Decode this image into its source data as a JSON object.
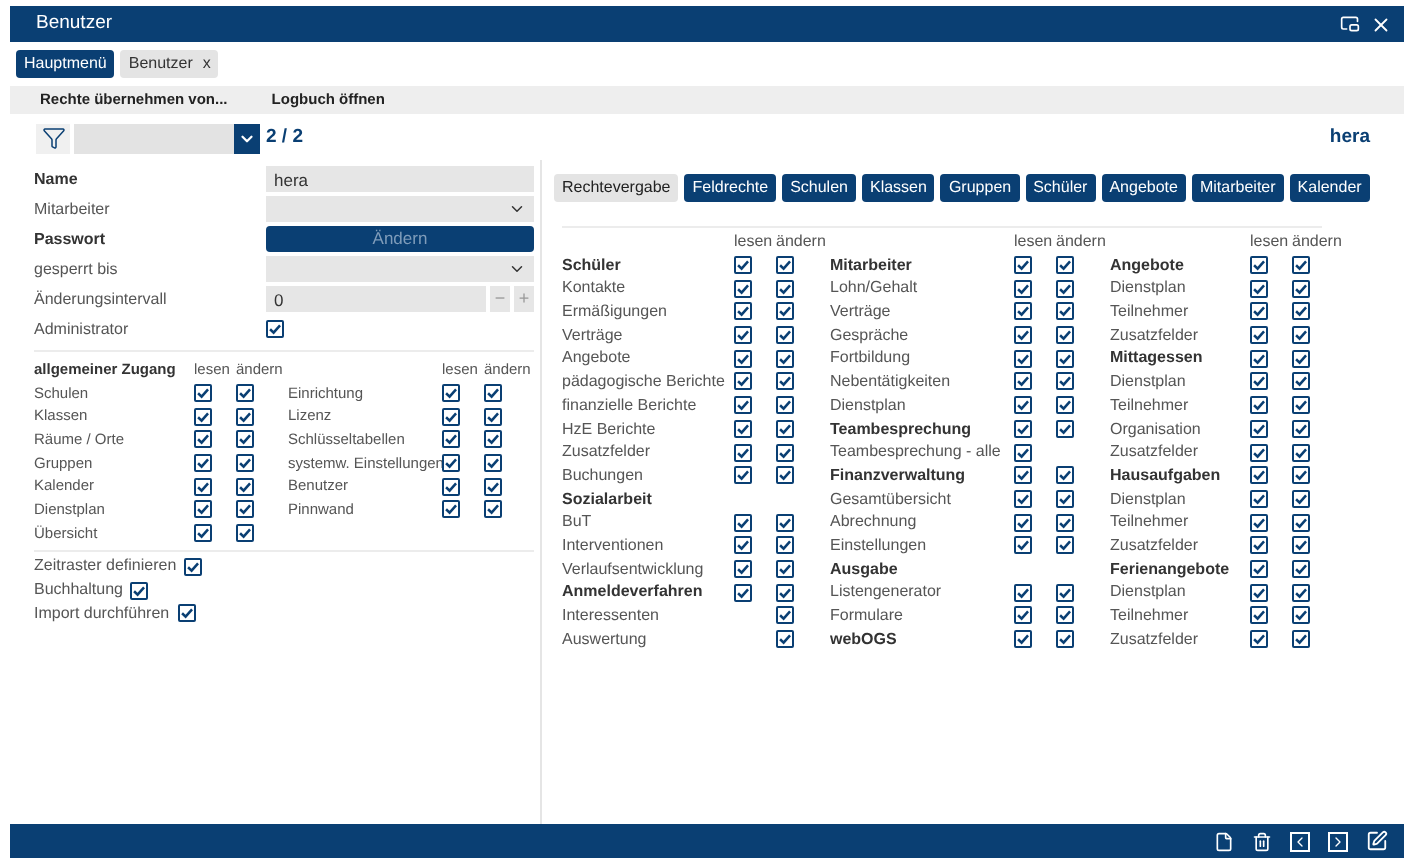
{
  "window": {
    "title": "Benutzer"
  },
  "tabs": [
    {
      "label": "Hauptmenü",
      "selected": true
    },
    {
      "label": "Benutzer",
      "selected": false,
      "close": "x"
    }
  ],
  "toolbar": [
    "Rechte übernehmen von...",
    "Logbuch öffnen"
  ],
  "navigator": {
    "counter": "2 / 2",
    "user": "hera"
  },
  "form": [
    {
      "kind": "text",
      "label": "Name",
      "required": true,
      "value": "hera"
    },
    {
      "kind": "select",
      "label": "Mitarbeiter",
      "required": false
    },
    {
      "kind": "button",
      "label": "Passwort",
      "required": true,
      "button": "Ändern",
      "disabled": true
    },
    {
      "kind": "select",
      "label": "gesperrt bis",
      "required": false
    },
    {
      "kind": "stepper",
      "label": "Änderungsintervall",
      "required": false,
      "value": "0",
      "minus": "−",
      "plus": "+"
    },
    {
      "kind": "checkbox",
      "label": "Administrator",
      "required": false,
      "checked": true
    }
  ],
  "general_access": {
    "title": "allgemeiner Zugang",
    "headers": [
      "lesen",
      "ändern"
    ],
    "left": [
      {
        "label": "Schulen",
        "read": true,
        "write": true
      },
      {
        "label": "Klassen",
        "read": true,
        "write": true
      },
      {
        "label": "Räume / Orte",
        "read": true,
        "write": true
      },
      {
        "label": "Gruppen",
        "read": true,
        "write": true
      },
      {
        "label": "Kalender",
        "read": true,
        "write": true
      },
      {
        "label": "Dienstplan",
        "read": true,
        "write": true
      },
      {
        "label": "Übersicht",
        "read": true,
        "write": true
      }
    ],
    "right_headers": [
      "lesen",
      "ändern"
    ],
    "right": [
      {
        "label": "Einrichtung",
        "read": true,
        "write": true
      },
      {
        "label": "Lizenz",
        "read": true,
        "write": true
      },
      {
        "label": "Schlüsseltabellen",
        "read": true,
        "write": true
      },
      {
        "label": "systemw. Einstellungen",
        "read": true,
        "write": true
      },
      {
        "label": "Benutzer",
        "read": true,
        "write": true
      },
      {
        "label": "Pinnwand",
        "read": true,
        "write": true
      }
    ]
  },
  "extra_rights": [
    {
      "label": "Zeitraster definieren",
      "checked": true
    },
    {
      "label": "Buchhaltung",
      "checked": true
    },
    {
      "label": "Import durchführen",
      "checked": true
    }
  ],
  "section_tabs": [
    {
      "label": "Rechtevergabe",
      "selected": true
    },
    {
      "label": "Feldrechte",
      "selected": false
    },
    {
      "label": "Schulen",
      "selected": false
    },
    {
      "label": "Klassen",
      "selected": false
    },
    {
      "label": "Gruppen",
      "selected": false
    },
    {
      "label": "Schüler",
      "selected": false
    },
    {
      "label": "Angebote",
      "selected": false
    },
    {
      "label": "Mitarbeiter",
      "selected": false
    },
    {
      "label": "Kalender",
      "selected": false
    }
  ],
  "rights_columns": [
    {
      "headers": [
        "lesen",
        "ändern"
      ],
      "rows": [
        {
          "label": "Schüler",
          "group": true,
          "read": true,
          "write": true
        },
        {
          "label": "Kontakte",
          "group": false,
          "read": true,
          "write": true
        },
        {
          "label": "Ermäßigungen",
          "group": false,
          "read": true,
          "write": true
        },
        {
          "label": "Verträge",
          "group": false,
          "read": true,
          "write": true
        },
        {
          "label": "Angebote",
          "group": false,
          "read": true,
          "write": true
        },
        {
          "label": "pädagogische Berichte",
          "group": false,
          "read": true,
          "write": true
        },
        {
          "label": "finanzielle Berichte",
          "group": false,
          "read": true,
          "write": true
        },
        {
          "label": "HzE Berichte",
          "group": false,
          "read": true,
          "write": true
        },
        {
          "label": "Zusatzfelder",
          "group": false,
          "read": true,
          "write": true
        },
        {
          "label": "Buchungen",
          "group": false,
          "read": true,
          "write": true
        },
        {
          "label": "Sozialarbeit",
          "group": true
        },
        {
          "label": "BuT",
          "group": false,
          "read": true,
          "write": true
        },
        {
          "label": "Interventionen",
          "group": false,
          "read": true,
          "write": true
        },
        {
          "label": "Verlaufsentwicklung",
          "group": false,
          "read": true,
          "write": true
        },
        {
          "label": "Anmeldeverfahren",
          "group": true,
          "read": true,
          "write": true
        },
        {
          "label": "Interessenten",
          "group": false,
          "write": true
        },
        {
          "label": "Auswertung",
          "group": false,
          "write": true
        }
      ]
    },
    {
      "headers": [
        "lesen",
        "ändern"
      ],
      "rows": [
        {
          "label": "Mitarbeiter",
          "group": true,
          "read": true,
          "write": true
        },
        {
          "label": "Lohn/Gehalt",
          "group": false,
          "read": true,
          "write": true
        },
        {
          "label": "Verträge",
          "group": false,
          "read": true,
          "write": true
        },
        {
          "label": "Gespräche",
          "group": false,
          "read": true,
          "write": true
        },
        {
          "label": "Fortbildung",
          "group": false,
          "read": true,
          "write": true
        },
        {
          "label": "Nebentätigkeiten",
          "group": false,
          "read": true,
          "write": true
        },
        {
          "label": "Dienstplan",
          "group": false,
          "read": true,
          "write": true
        },
        {
          "label": "Teambesprechung",
          "group": true,
          "read": true,
          "write": true
        },
        {
          "label": "Teambesprechung - alle",
          "group": false,
          "read": true
        },
        {
          "label": "Finanzverwaltung",
          "group": true,
          "read": true,
          "write": true
        },
        {
          "label": "Gesamtübersicht",
          "group": false,
          "read": true,
          "write": true
        },
        {
          "label": "Abrechnung",
          "group": false,
          "read": true,
          "write": true
        },
        {
          "label": "Einstellungen",
          "group": false,
          "read": true,
          "write": true
        },
        {
          "label": "Ausgabe",
          "group": true
        },
        {
          "label": "Listengenerator",
          "group": false,
          "read": true,
          "write": true
        },
        {
          "label": "Formulare",
          "group": false,
          "read": true,
          "write": true
        },
        {
          "label": "webOGS",
          "group": true,
          "read": true,
          "write": true
        }
      ]
    },
    {
      "headers": [
        "lesen",
        "ändern"
      ],
      "rows": [
        {
          "label": "Angebote",
          "group": true,
          "read": true,
          "write": true
        },
        {
          "label": "Dienstplan",
          "group": false,
          "read": true,
          "write": true
        },
        {
          "label": "Teilnehmer",
          "group": false,
          "read": true,
          "write": true
        },
        {
          "label": "Zusatzfelder",
          "group": false,
          "read": true,
          "write": true
        },
        {
          "label": "Mittagessen",
          "group": true,
          "read": true,
          "write": true
        },
        {
          "label": "Dienstplan",
          "group": false,
          "read": true,
          "write": true
        },
        {
          "label": "Teilnehmer",
          "group": false,
          "read": true,
          "write": true
        },
        {
          "label": "Organisation",
          "group": false,
          "read": true,
          "write": true
        },
        {
          "label": "Zusatzfelder",
          "group": false,
          "read": true,
          "write": true
        },
        {
          "label": "Hausaufgaben",
          "group": true,
          "read": true,
          "write": true
        },
        {
          "label": "Dienstplan",
          "group": false,
          "read": true,
          "write": true
        },
        {
          "label": "Teilnehmer",
          "group": false,
          "read": true,
          "write": true
        },
        {
          "label": "Zusatzfelder",
          "group": false,
          "read": true,
          "write": true
        },
        {
          "label": "Ferienangebote",
          "group": true,
          "read": true,
          "write": true
        },
        {
          "label": "Dienstplan",
          "group": false,
          "read": true,
          "write": true
        },
        {
          "label": "Teilnehmer",
          "group": false,
          "read": true,
          "write": true
        },
        {
          "label": "Zusatzfelder",
          "group": false,
          "read": true,
          "write": true
        }
      ]
    }
  ]
}
